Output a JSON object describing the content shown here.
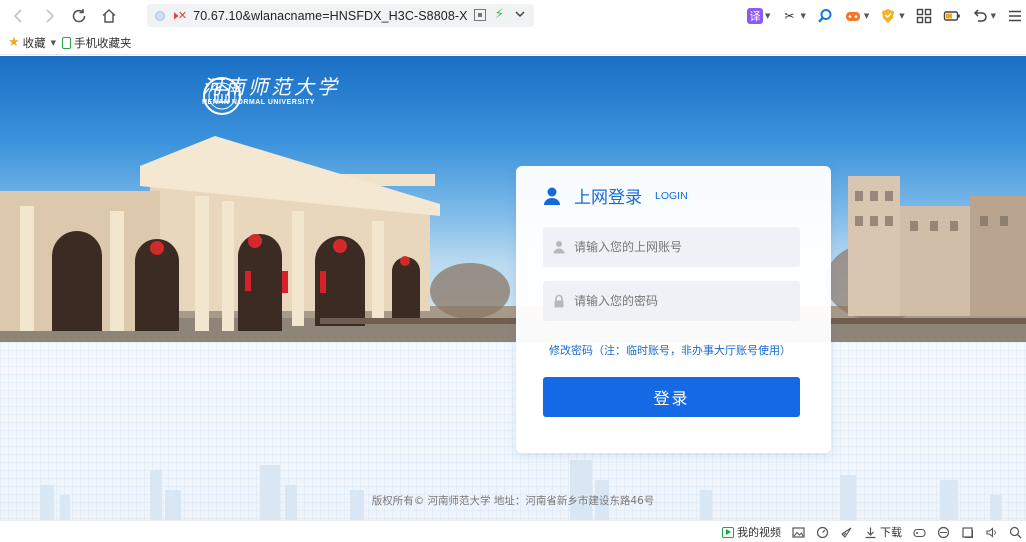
{
  "browser": {
    "address_url": "70.67.10&wlanacname=HNSFDX_H3C-S8808-X",
    "translate_badge": "译",
    "bookmarks": [
      {
        "label": "收藏"
      },
      {
        "label": "手机收藏夹"
      }
    ],
    "status_video_label": "我的视频",
    "status_download_label": "下载"
  },
  "university": {
    "name_cn": "河南师范大学",
    "name_en": "HENAN NORMAL UNIVERSITY"
  },
  "login": {
    "title": "上网登录",
    "subtitle": "LOGIN",
    "username_placeholder": "请输入您的上网账号",
    "password_placeholder": "请输入您的密码",
    "change_password_link": "修改密码（注：临时账号，非办事大厅账号使用）",
    "submit_label": "登录"
  },
  "footer": {
    "copyright": "版权所有© 河南师范大学 地址：河南省新乡市建设东路46号"
  },
  "colors": {
    "primary": "#1669e5",
    "link": "#1a6ad0",
    "field_bg": "#eef1f5"
  }
}
